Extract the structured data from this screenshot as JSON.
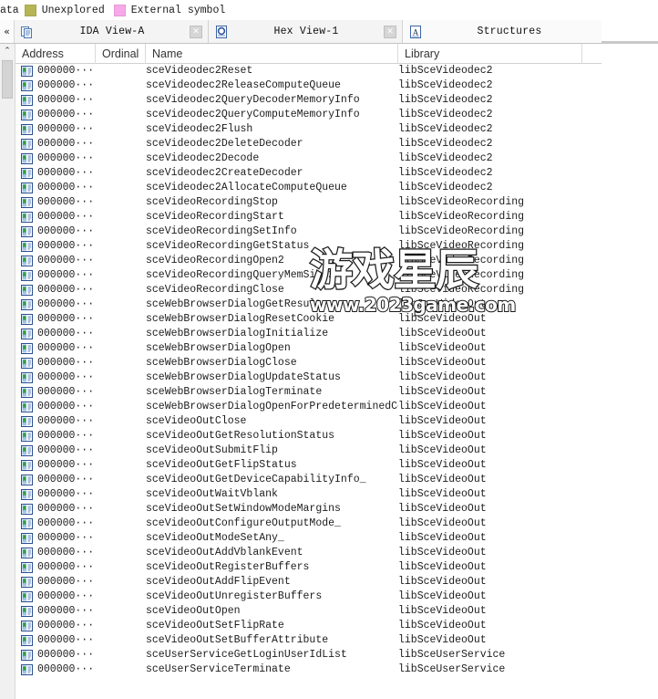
{
  "legend": {
    "clipped_text": "ata",
    "items": [
      {
        "label": "Unexplored",
        "color": "#b5b555"
      },
      {
        "label": "External symbol",
        "color": "#f7a8e8"
      }
    ]
  },
  "collapse_button": {
    "glyph": "«"
  },
  "tabs": [
    {
      "label": "IDA View-A",
      "icon": "document-pages-icon",
      "closable": true,
      "close_glyph": "✕"
    },
    {
      "label": "Hex View-1",
      "icon": "hex-circle-icon",
      "closable": true,
      "close_glyph": "✕"
    },
    {
      "label": "Structures",
      "icon": "letter-a-icon",
      "closable": false,
      "close_glyph": ""
    }
  ],
  "scrollbar": {
    "up_glyph": "⌃"
  },
  "table": {
    "columns": [
      {
        "key": "address",
        "label": "Address"
      },
      {
        "key": "ordinal",
        "label": "Ordinal"
      },
      {
        "key": "name",
        "label": "Name"
      },
      {
        "key": "library",
        "label": "Library"
      }
    ],
    "sort_chevron": "⌄",
    "address_placeholder": "000000···",
    "row_icon": "export-entry-icon",
    "rows": [
      {
        "address": "000000···",
        "ordinal": "",
        "name": "sceVideodec2Reset",
        "library": "libSceVideodec2"
      },
      {
        "address": "000000···",
        "ordinal": "",
        "name": "sceVideodec2ReleaseComputeQueue",
        "library": "libSceVideodec2"
      },
      {
        "address": "000000···",
        "ordinal": "",
        "name": "sceVideodec2QueryDecoderMemoryInfo",
        "library": "libSceVideodec2"
      },
      {
        "address": "000000···",
        "ordinal": "",
        "name": "sceVideodec2QueryComputeMemoryInfo",
        "library": "libSceVideodec2"
      },
      {
        "address": "000000···",
        "ordinal": "",
        "name": "sceVideodec2Flush",
        "library": "libSceVideodec2"
      },
      {
        "address": "000000···",
        "ordinal": "",
        "name": "sceVideodec2DeleteDecoder",
        "library": "libSceVideodec2"
      },
      {
        "address": "000000···",
        "ordinal": "",
        "name": "sceVideodec2Decode",
        "library": "libSceVideodec2"
      },
      {
        "address": "000000···",
        "ordinal": "",
        "name": "sceVideodec2CreateDecoder",
        "library": "libSceVideodec2"
      },
      {
        "address": "000000···",
        "ordinal": "",
        "name": "sceVideodec2AllocateComputeQueue",
        "library": "libSceVideodec2"
      },
      {
        "address": "000000···",
        "ordinal": "",
        "name": "sceVideoRecordingStop",
        "library": "libSceVideoRecording"
      },
      {
        "address": "000000···",
        "ordinal": "",
        "name": "sceVideoRecordingStart",
        "library": "libSceVideoRecording"
      },
      {
        "address": "000000···",
        "ordinal": "",
        "name": "sceVideoRecordingSetInfo",
        "library": "libSceVideoRecording"
      },
      {
        "address": "000000···",
        "ordinal": "",
        "name": "sceVideoRecordingGetStatus",
        "library": "libSceVideoRecording"
      },
      {
        "address": "000000···",
        "ordinal": "",
        "name": "sceVideoRecordingOpen2",
        "library": "libSceVideoRecording"
      },
      {
        "address": "000000···",
        "ordinal": "",
        "name": "sceVideoRecordingQueryMemSize2",
        "library": "libSceVideoRecording"
      },
      {
        "address": "000000···",
        "ordinal": "",
        "name": "sceVideoRecordingClose",
        "library": "libSceVideoRecording"
      },
      {
        "address": "000000···",
        "ordinal": "",
        "name": "sceWebBrowserDialogGetResult",
        "library": "libSceVideoOut"
      },
      {
        "address": "000000···",
        "ordinal": "",
        "name": "sceWebBrowserDialogResetCookie",
        "library": "libSceVideoOut"
      },
      {
        "address": "000000···",
        "ordinal": "",
        "name": "sceWebBrowserDialogInitialize",
        "library": "libSceVideoOut"
      },
      {
        "address": "000000···",
        "ordinal": "",
        "name": "sceWebBrowserDialogOpen",
        "library": "libSceVideoOut"
      },
      {
        "address": "000000···",
        "ordinal": "",
        "name": "sceWebBrowserDialogClose",
        "library": "libSceVideoOut"
      },
      {
        "address": "000000···",
        "ordinal": "",
        "name": "sceWebBrowserDialogUpdateStatus",
        "library": "libSceVideoOut"
      },
      {
        "address": "000000···",
        "ordinal": "",
        "name": "sceWebBrowserDialogTerminate",
        "library": "libSceVideoOut"
      },
      {
        "address": "000000···",
        "ordinal": "",
        "name": "sceWebBrowserDialogOpenForPredeterminedCon···",
        "library": "libSceVideoOut"
      },
      {
        "address": "000000···",
        "ordinal": "",
        "name": "sceVideoOutClose",
        "library": "libSceVideoOut"
      },
      {
        "address": "000000···",
        "ordinal": "",
        "name": "sceVideoOutGetResolutionStatus",
        "library": "libSceVideoOut"
      },
      {
        "address": "000000···",
        "ordinal": "",
        "name": "sceVideoOutSubmitFlip",
        "library": "libSceVideoOut"
      },
      {
        "address": "000000···",
        "ordinal": "",
        "name": "sceVideoOutGetFlipStatus",
        "library": "libSceVideoOut"
      },
      {
        "address": "000000···",
        "ordinal": "",
        "name": "sceVideoOutGetDeviceCapabilityInfo_",
        "library": "libSceVideoOut"
      },
      {
        "address": "000000···",
        "ordinal": "",
        "name": "sceVideoOutWaitVblank",
        "library": "libSceVideoOut"
      },
      {
        "address": "000000···",
        "ordinal": "",
        "name": "sceVideoOutSetWindowModeMargins",
        "library": "libSceVideoOut"
      },
      {
        "address": "000000···",
        "ordinal": "",
        "name": "sceVideoOutConfigureOutputMode_",
        "library": "libSceVideoOut"
      },
      {
        "address": "000000···",
        "ordinal": "",
        "name": "sceVideoOutModeSetAny_",
        "library": "libSceVideoOut"
      },
      {
        "address": "000000···",
        "ordinal": "",
        "name": "sceVideoOutAddVblankEvent",
        "library": "libSceVideoOut"
      },
      {
        "address": "000000···",
        "ordinal": "",
        "name": "sceVideoOutRegisterBuffers",
        "library": "libSceVideoOut"
      },
      {
        "address": "000000···",
        "ordinal": "",
        "name": "sceVideoOutAddFlipEvent",
        "library": "libSceVideoOut"
      },
      {
        "address": "000000···",
        "ordinal": "",
        "name": "sceVideoOutUnregisterBuffers",
        "library": "libSceVideoOut"
      },
      {
        "address": "000000···",
        "ordinal": "",
        "name": "sceVideoOutOpen",
        "library": "libSceVideoOut"
      },
      {
        "address": "000000···",
        "ordinal": "",
        "name": "sceVideoOutSetFlipRate",
        "library": "libSceVideoOut"
      },
      {
        "address": "000000···",
        "ordinal": "",
        "name": "sceVideoOutSetBufferAttribute",
        "library": "libSceVideoOut"
      },
      {
        "address": "000000···",
        "ordinal": "",
        "name": "sceUserServiceGetLoginUserIdList",
        "library": "libSceUserService"
      },
      {
        "address": "000000···",
        "ordinal": "",
        "name": "sceUserServiceTerminate",
        "library": "libSceUserService"
      }
    ]
  },
  "watermark": {
    "main": "游戏星辰",
    "sub": "www.2023game.com"
  }
}
